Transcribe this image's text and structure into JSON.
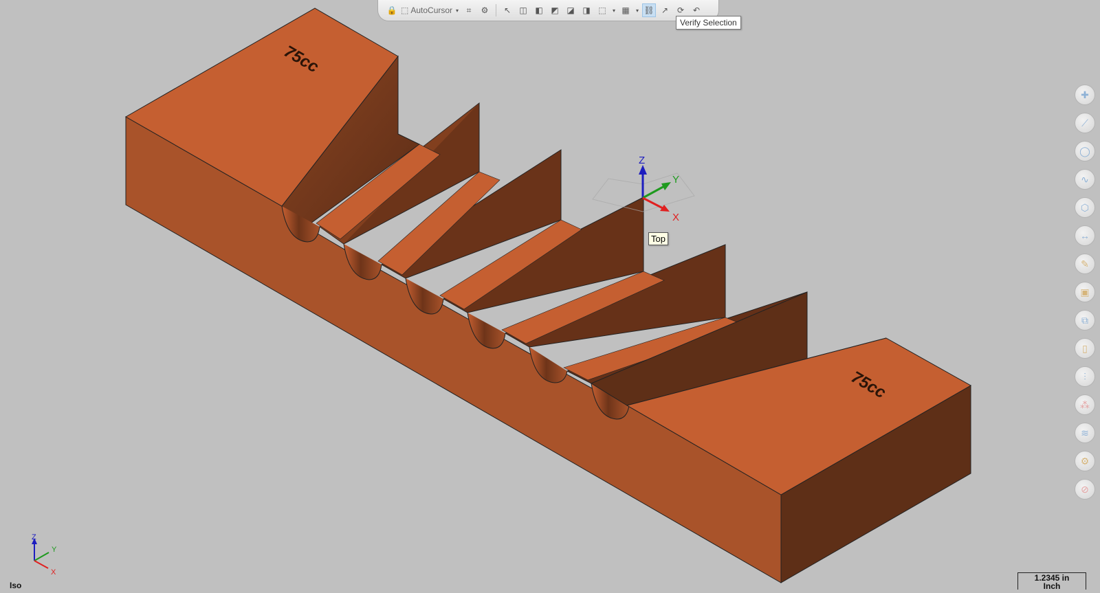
{
  "toolbar": {
    "autocursor_label": "AutoCursor",
    "icons": [
      "lock-icon",
      "select-pointer-icon",
      "xyz-icon",
      "gear-icon",
      "arrow-icon",
      "cube-icons",
      "box-select-icon",
      "grid-select-icon",
      "verify-selection-icon",
      "rotate-icon",
      "undo-icon"
    ]
  },
  "tooltips": {
    "verify_selection": "Verify Selection",
    "view_top": "Top"
  },
  "model": {
    "label_left": "75cc",
    "label_right": "75cc",
    "color_top": "#c55f31",
    "color_front": "#a9532a",
    "color_side": "#5e2f17",
    "color_groove": "#7a3b1d"
  },
  "gnomon": {
    "x": "X",
    "y": "Y",
    "z": "Z",
    "color_x": "#e02020",
    "color_y": "#1e9a1e",
    "color_z": "#1d1dbf"
  },
  "status": {
    "view_name": "Iso",
    "scale_value": "1.2345 in",
    "scale_unit": "Inch"
  },
  "right_toolbar": [
    "add-point-icon",
    "line-icon",
    "circle-icon",
    "spline-icon",
    "solid-icon",
    "dimension-icon",
    "wrench-icon",
    "box-icon",
    "transform-icon",
    "mirror-icon",
    "section-icon",
    "pattern-icon",
    "layers-icon",
    "settings-gear-icon",
    "no-entry-icon"
  ]
}
